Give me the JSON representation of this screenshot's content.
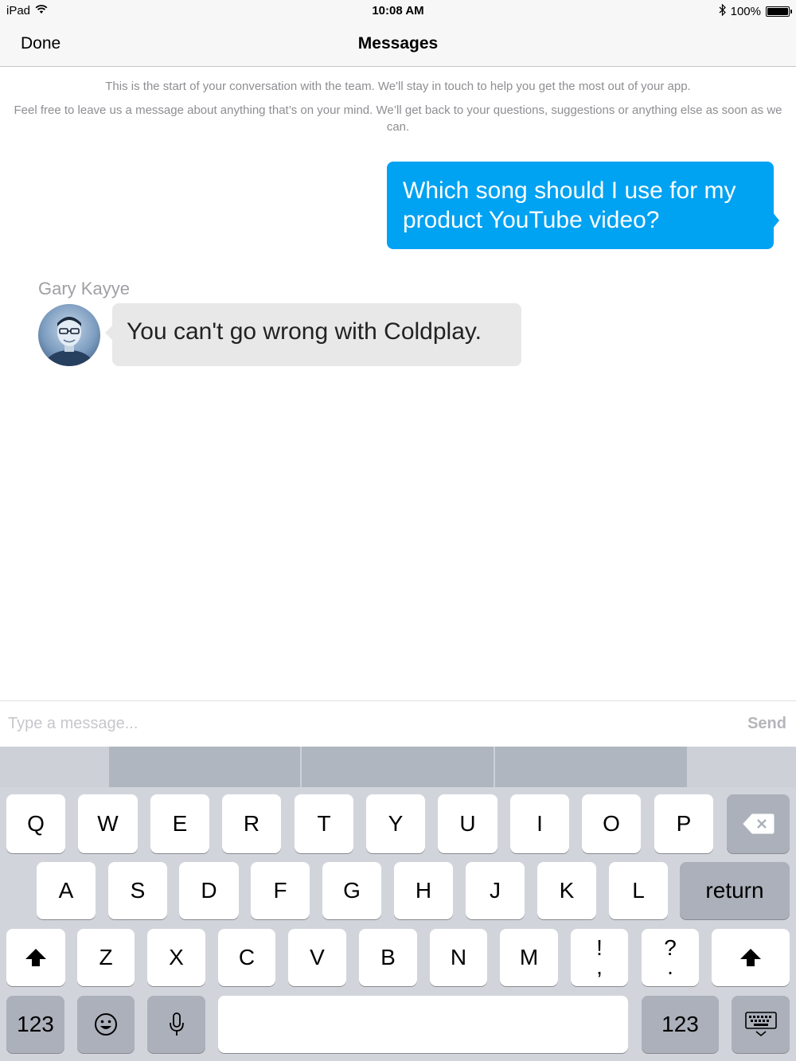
{
  "status_bar": {
    "device": "iPad",
    "time": "10:08 AM",
    "battery": "100%",
    "battery_level": 1.0,
    "wifi_icon": "wifi-icon",
    "bluetooth_icon": "bluetooth-icon"
  },
  "nav": {
    "done_label": "Done",
    "title": "Messages"
  },
  "intro": {
    "line1": "This is the start of your conversation with the  team. We'll stay in touch to help you get the most out of your app.",
    "line2": "Feel free to leave us a message about anything that’s on your mind. We’ll get back to your questions, suggestions or anything else as soon as we can."
  },
  "messages": [
    {
      "direction": "outgoing",
      "text": "Which song should I use for my product YouTube video?"
    },
    {
      "direction": "incoming",
      "sender": "Gary Kayye",
      "text": "You can't go wrong with Coldplay."
    }
  ],
  "composer": {
    "placeholder": "Type a message...",
    "send_label": "Send"
  },
  "keyboard": {
    "row1": [
      "Q",
      "W",
      "E",
      "R",
      "T",
      "Y",
      "U",
      "I",
      "O",
      "P"
    ],
    "row2": [
      "A",
      "S",
      "D",
      "F",
      "G",
      "H",
      "J",
      "K",
      "L"
    ],
    "row3": [
      "Z",
      "X",
      "C",
      "V",
      "B",
      "N",
      "M"
    ],
    "return_label": "return",
    "numbers_label": "123",
    "punct1": {
      "top": "!",
      "bottom": ","
    },
    "punct2": {
      "top": "?",
      "bottom": "."
    },
    "colors": {
      "accent": "#00a2f2",
      "keyboard_bg": "#d1d5db",
      "key_dark": "#abb0ba"
    }
  }
}
